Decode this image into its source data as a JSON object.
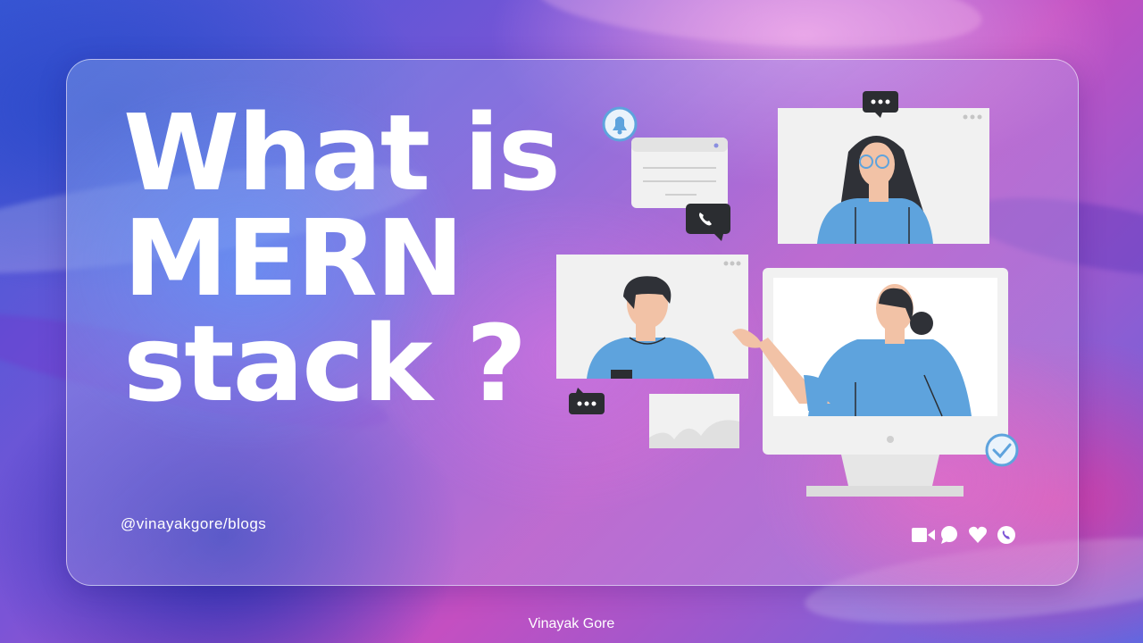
{
  "headline": {
    "line1": "What is",
    "line2": "MERN",
    "line3": "stack ?"
  },
  "handle": "@vinayakgore/blogs",
  "author": "Vinayak Gore",
  "colors": {
    "text": "#ffffff",
    "skin": "#f2c2a6",
    "shirt": "#5ea3dd",
    "hair": "#2f3137",
    "panel": "#f1f1f1",
    "bubble": "#2b2d31"
  },
  "icons": [
    "video-icon",
    "chat-icon",
    "heart-icon",
    "phone-icon"
  ],
  "illustration_icons": [
    "bell-icon",
    "phone-call-icon",
    "chat-dots-icon",
    "check-icon"
  ]
}
